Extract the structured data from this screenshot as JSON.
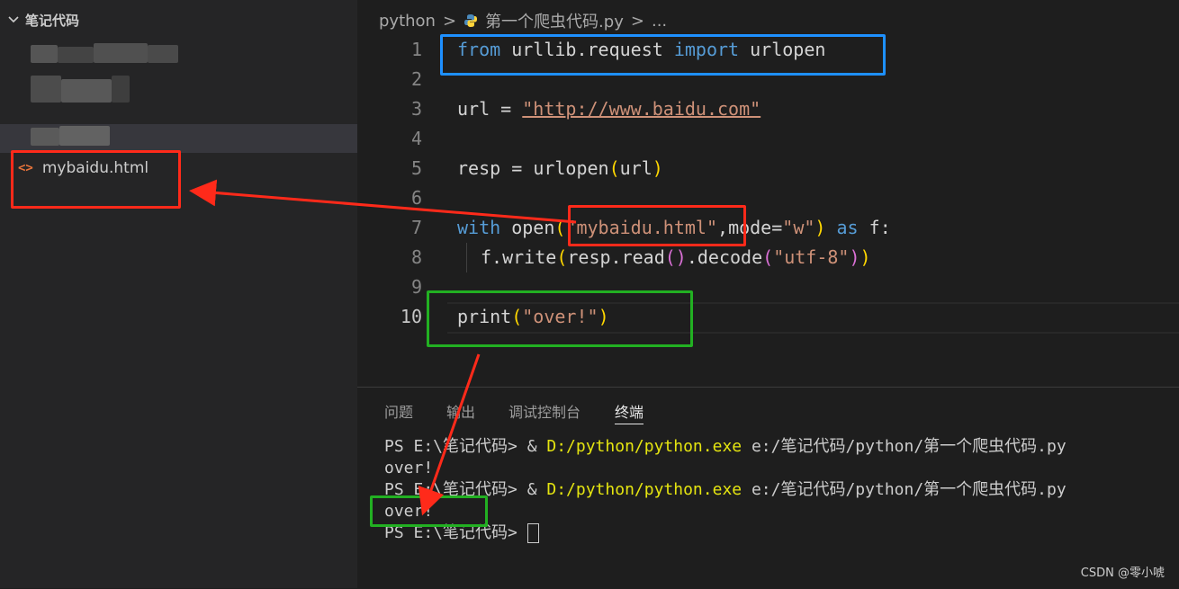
{
  "explorer": {
    "folder_name": "笔记代码",
    "file_name": "mybaidu.html",
    "file_icon_glyph": "<>"
  },
  "breadcrumb": {
    "folder": "python",
    "separator": ">",
    "file": "第一个爬虫代码.py",
    "trailing": "..."
  },
  "editor": {
    "line_numbers": [
      "1",
      "2",
      "3",
      "4",
      "5",
      "6",
      "7",
      "8",
      "9",
      "10"
    ],
    "active_line": "10",
    "lines": {
      "l1": {
        "kw_from": "from",
        "module": "urllib.request",
        "kw_import": "import",
        "name": "urlopen"
      },
      "l3": {
        "var": "url",
        "op": "=",
        "str": "\"http://www.baidu.com\""
      },
      "l5": {
        "var": "resp",
        "op": "=",
        "fn": "urlopen",
        "arg": "url"
      },
      "l7": {
        "kw_with": "with",
        "fn": "open",
        "str1": "\"mybaidu.html\"",
        "param": "mode",
        "str2": "\"w\"",
        "kw_as": "as",
        "alias": "f"
      },
      "l8": {
        "obj": "f",
        "write": "write",
        "resp": "resp",
        "read": "read",
        "decode": "decode",
        "str": "\"utf-8\""
      },
      "l10": {
        "fn": "print",
        "str": "\"over!\""
      }
    }
  },
  "panel": {
    "tabs": [
      "问题",
      "输出",
      "调试控制台",
      "终端"
    ],
    "active_tab": "终端",
    "terminal": [
      {
        "prompt": "PS E:\\笔记代码> & ",
        "exe": "D:/python/python.exe",
        "rest": " e:/笔记代码/python/第一个爬虫代码.py"
      },
      {
        "text": "over!"
      },
      {
        "prompt": "PS E:\\笔记代码> & ",
        "exe": "D:/python/python.exe",
        "rest": " e:/笔记代码/python/第一个爬虫代码.py"
      },
      {
        "text": "over!"
      },
      {
        "prompt": "PS E:\\笔记代码> "
      }
    ]
  },
  "watermark": "CSDN @零小唬",
  "colors": {
    "annotation_blue": "#1e90ff",
    "annotation_red": "#ff2a1a",
    "annotation_green": "#22b022"
  }
}
